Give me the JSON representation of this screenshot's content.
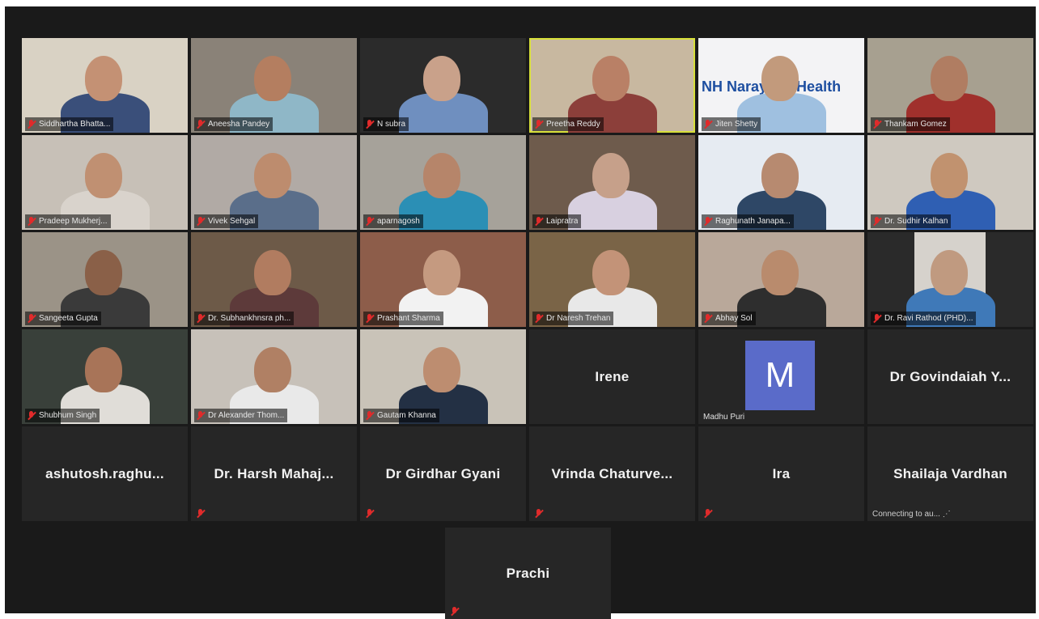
{
  "video_participants": [
    {
      "name": "Siddhartha Bhatta...",
      "bg": "#d9d2c4",
      "face": "#c49174",
      "shirt": "#3a4f7a"
    },
    {
      "name": "Aneesha Pandey",
      "bg": "#8a8278",
      "face": "#b47e60",
      "shirt": "#8fb7c7"
    },
    {
      "name": "N subra",
      "bg": "#2b2b2b",
      "face": "#c9a18a",
      "shirt": "#6f8fbf"
    },
    {
      "name": "Preetha Reddy",
      "bg": "#c8b8a0",
      "face": "#b98066",
      "shirt": "#8c3f3a",
      "active": true
    },
    {
      "name": "Jiten Shetty",
      "bg": "#f3f3f5",
      "face": "#c29a7c",
      "shirt": "#9fc0e0",
      "logo": "NH Narayana Health"
    },
    {
      "name": "Thankam Gomez",
      "bg": "#a7a090",
      "face": "#b07d62",
      "shirt": "#a0302c"
    },
    {
      "name": "Pradeep Mukherj...",
      "bg": "#c7c0b7",
      "face": "#c09072",
      "shirt": "#d9d3cc"
    },
    {
      "name": "Vivek Sehgal",
      "bg": "#b1aaa5",
      "face": "#bd8c6e",
      "shirt": "#5a6e8a"
    },
    {
      "name": "aparnagosh",
      "bg": "#a6a29a",
      "face": "#b6856a",
      "shirt": "#2b8fb5"
    },
    {
      "name": "Laipratra",
      "bg": "#6e5b4c",
      "face": "#c6a08a",
      "shirt": "#d8d0e0"
    },
    {
      "name": "Raghunath Janapa...",
      "bg": "#e6ebf2",
      "face": "#b78a70",
      "shirt": "#2e4766"
    },
    {
      "name": "Dr. Sudhir Kalhan",
      "bg": "#cfc9c0",
      "face": "#c1926f",
      "shirt": "#2f5fb3"
    },
    {
      "name": "Sangeeta Gupta",
      "bg": "#9b9387",
      "face": "#8a6048",
      "shirt": "#3a3a3a"
    },
    {
      "name": "Dr. Subhankhnsra ph...",
      "bg": "#6d5a48",
      "face": "#b17c60",
      "shirt": "#5d3a3a"
    },
    {
      "name": "Prashant Sharma",
      "bg": "#8d5d4a",
      "face": "#c59a80",
      "shirt": "#f2f2f2"
    },
    {
      "name": "Dr Naresh Trehan",
      "bg": "#7a6447",
      "face": "#c39378",
      "shirt": "#e8e8e8"
    },
    {
      "name": "Abhay Sol",
      "bg": "#b9a89a",
      "face": "#b98b6d",
      "shirt": "#2e2e2e"
    },
    {
      "name": "Dr. Ravi Rathod (PHD)...",
      "bg": "#2a2a2a",
      "face": "#c09a80",
      "shirt": "#3f79b8",
      "frame": true
    },
    {
      "name": "Shubhum Singh",
      "bg": "#39403a",
      "face": "#a87458",
      "shirt": "#e0ddd8"
    },
    {
      "name": "Dr Alexander Thom...",
      "bg": "#c7c1b9",
      "face": "#b08064",
      "shirt": "#e9e9e9"
    },
    {
      "name": "Gautam Khanna",
      "bg": "#c9c3b8",
      "face": "#bd8d70",
      "shirt": "#233044"
    }
  ],
  "text_participants": [
    {
      "name": "Irene",
      "mic_muted": false
    },
    {
      "name": "Madhu Puri",
      "avatar_letter": "M",
      "avatar": true
    },
    {
      "name": "Dr Govindaiah Y...",
      "mic_muted": false
    },
    {
      "name": "ashutosh.raghu...",
      "mic_muted": false
    },
    {
      "name": "Dr.  Harsh  Mahaj...",
      "mic_muted": true
    },
    {
      "name": "Dr Girdhar Gyani",
      "mic_muted": true
    },
    {
      "name": "Vrinda  Chaturve...",
      "mic_muted": true
    },
    {
      "name": "Ira",
      "mic_muted": true
    },
    {
      "name": "Shailaja Vardhan",
      "mic_muted": false,
      "status": "Connecting to au...  ⋰"
    }
  ],
  "last_participant": {
    "name": "Prachi",
    "mic_muted": true
  },
  "colors": {
    "active_speaker": "#d8e03a",
    "muted": "#e02b2b",
    "avatar": "#5a6bc9",
    "tile": "#262626",
    "background": "#1a1a1a"
  }
}
